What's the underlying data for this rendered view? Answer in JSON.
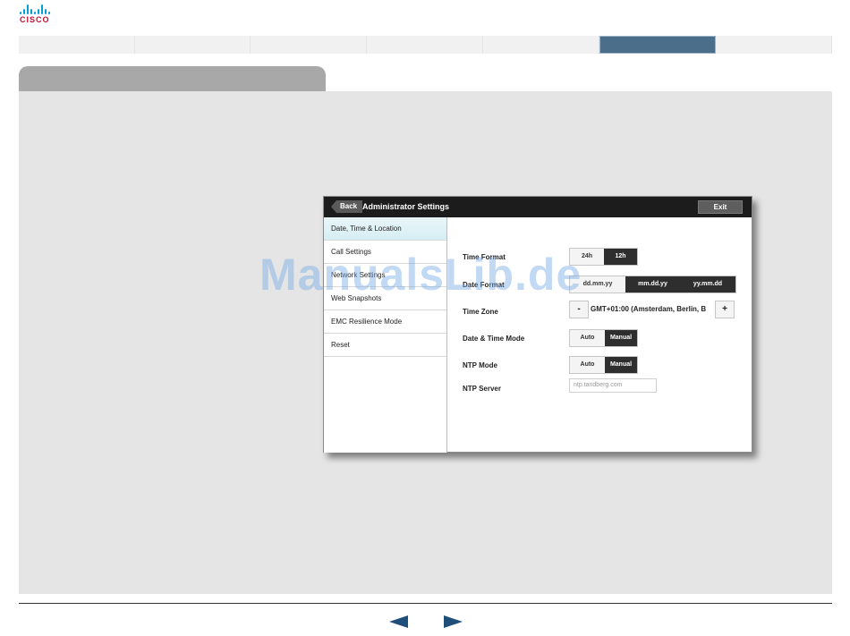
{
  "brand": {
    "logo_text": "CISCO",
    "color": "#c8102e",
    "bars_color": "#049fd9"
  },
  "nav": {
    "segments": 7,
    "active_index": 5,
    "active_color": "#4b6e8b"
  },
  "device": {
    "back_label": "Back",
    "title": "Administrator Settings",
    "exit_label": "Exit",
    "menu": [
      {
        "label": "Date, Time & Location",
        "active": true
      },
      {
        "label": "Call Settings",
        "active": false
      },
      {
        "label": "Network Settings",
        "active": false
      },
      {
        "label": "Web Snapshots",
        "active": false
      },
      {
        "label": "EMC Resilience Mode",
        "active": false
      },
      {
        "label": "Reset",
        "active": false
      }
    ],
    "settings": {
      "time_format": {
        "label": "Time Format",
        "options": [
          "24h",
          "12h"
        ],
        "selected": "12h"
      },
      "date_format": {
        "label": "Date Format",
        "options": [
          "dd.mm.yy",
          "mm.dd.yy",
          "yy.mm.dd"
        ],
        "selected": [
          "mm.dd.yy",
          "yy.mm.dd"
        ]
      },
      "time_zone": {
        "label": "Time Zone",
        "minus": "-",
        "plus": "+",
        "value": "GMT+01:00 (Amsterdam, Berlin, B"
      },
      "date_time_mode": {
        "label": "Date & Time Mode",
        "options": [
          "Auto",
          "Manual"
        ],
        "selected": "Manual"
      },
      "ntp_mode": {
        "label": "NTP Mode",
        "options": [
          "Auto",
          "Manual"
        ],
        "selected": "Manual"
      },
      "ntp_server": {
        "label": "NTP Server",
        "placeholder": "ntp.tandberg.com"
      }
    }
  },
  "watermark": "ManualsLib.de",
  "footer": {
    "prev_icon": "arrow-left-icon",
    "next_icon": "arrow-right-icon"
  }
}
